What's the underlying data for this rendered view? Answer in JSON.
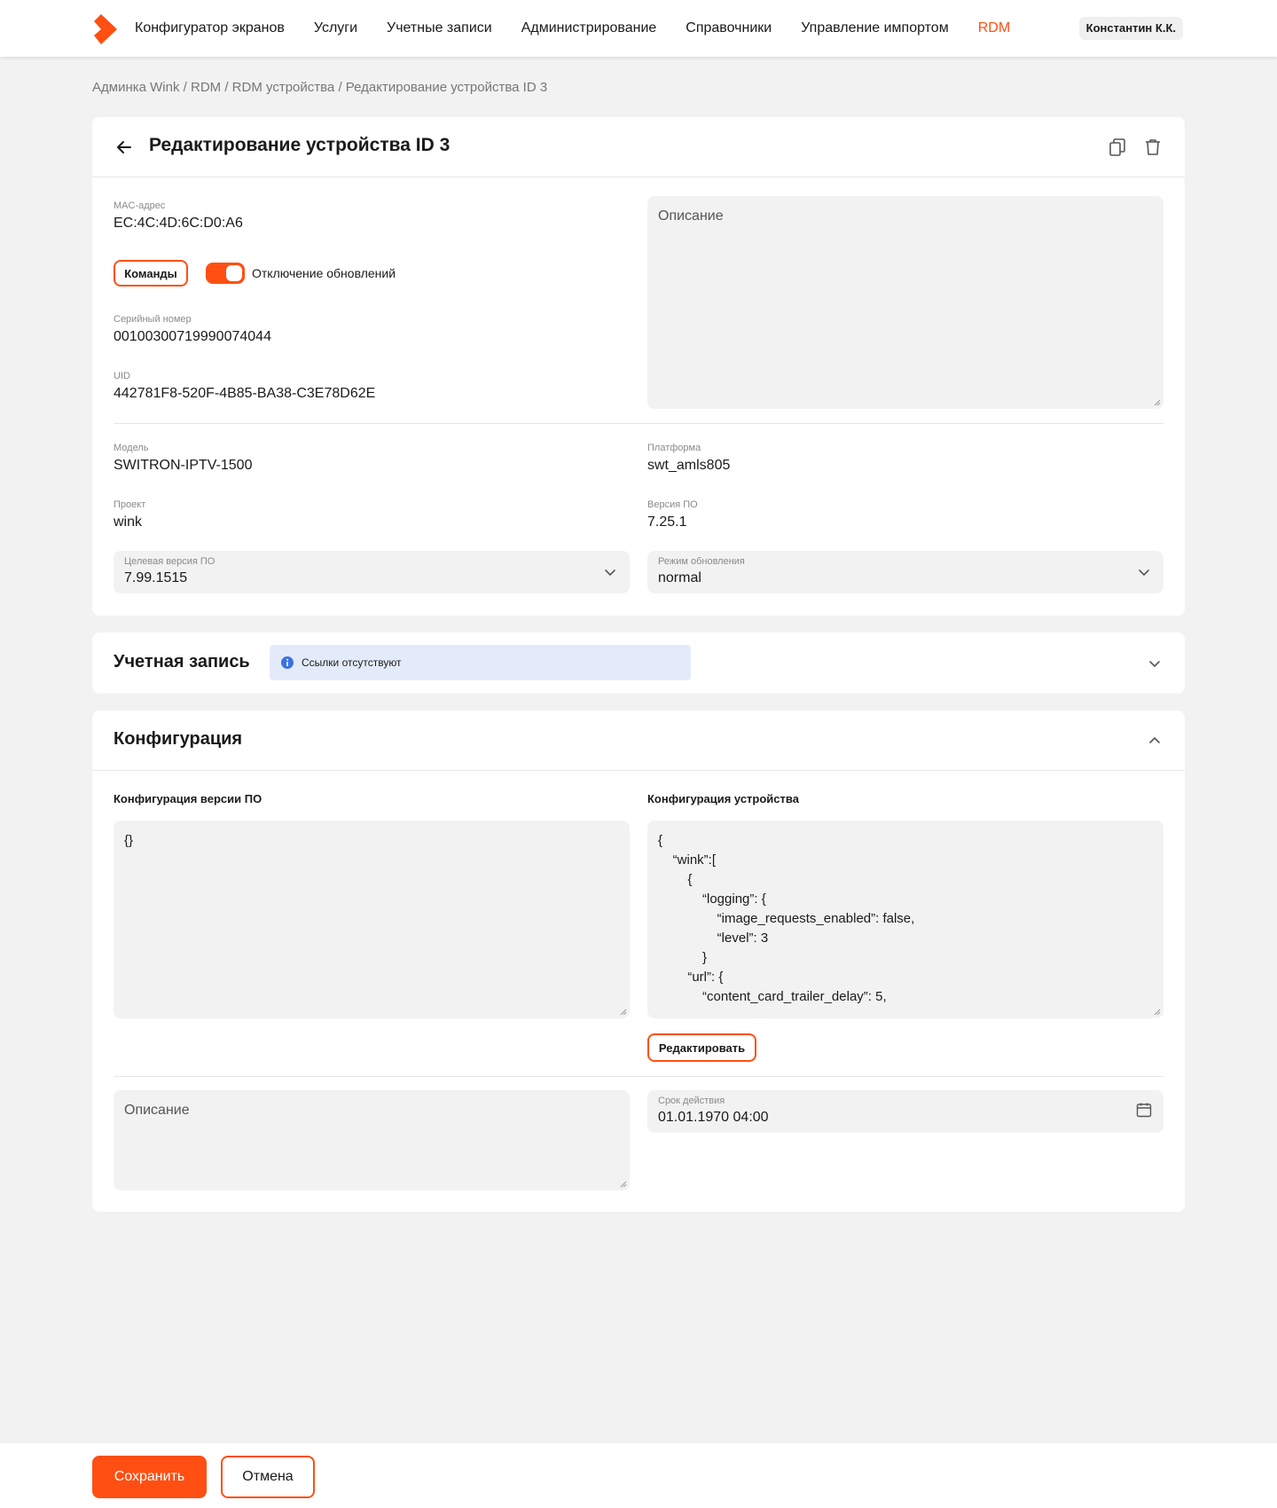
{
  "brand": {
    "accent_color": "#ff4f12",
    "logo_icon": "wink-logo-icon"
  },
  "nav": {
    "items": [
      {
        "label": "Конфигуратор экранов"
      },
      {
        "label": "Услуги"
      },
      {
        "label": "Учетные записи"
      },
      {
        "label": "Администрирование"
      },
      {
        "label": "Справочники"
      },
      {
        "label": "Управление импортом"
      },
      {
        "label": "RDM",
        "active": true
      }
    ],
    "user": "Константин К.К."
  },
  "breadcrumb": {
    "items": [
      "Админка Wink",
      "RDM",
      "RDM устройства",
      "Редактирование устройства ID 3"
    ],
    "separator": " / "
  },
  "device": {
    "title": "Редактирование устройства ID 3",
    "mac": {
      "label": "MAC-адрес",
      "value": "EC:4C:4D:6C:D0:A6"
    },
    "commands_button": "Команды",
    "updates_toggle": {
      "label": "Отключение обновлений",
      "on": true
    },
    "serial": {
      "label": "Серийный номер",
      "value": "00100300719990074044"
    },
    "uid": {
      "label": "UID",
      "value": "442781F8-520F-4B85-BA38-C3E78D62E"
    },
    "description_placeholder": "Описание",
    "model": {
      "label": "Модель",
      "value": "SWITRON-IPTV-1500"
    },
    "platform": {
      "label": "Платформа",
      "value": "swt_amls805"
    },
    "project": {
      "label": "Проект",
      "value": "wink"
    },
    "fw_version": {
      "label": "Версия ПО",
      "value": "7.25.1"
    },
    "target_fw": {
      "label": "Целевая версия ПО",
      "value": "7.99.1515"
    },
    "update_mode": {
      "label": "Режим обновления",
      "value": "normal"
    }
  },
  "account": {
    "title": "Учетная запись",
    "info": "Ссылки отсутствуют"
  },
  "config": {
    "title": "Конфигурация",
    "fw_config_label": "Конфигурация версии ПО",
    "fw_config_value": "{}",
    "device_config_label": "Конфигурация устройства",
    "device_config_lines": [
      "{",
      "    “wink”:[",
      "        {",
      "            “logging”: {",
      "                “image_requests_enabled”: false,",
      "                “level”: 3",
      "            }",
      "        “url”: {",
      "            “content_card_trailer_delay”: 5,"
    ],
    "edit_button": "Редактировать",
    "description_placeholder": "Описание",
    "expiry": {
      "label": "Срок действия",
      "value": "01.01.1970 04:00"
    }
  },
  "footer": {
    "save": "Сохранить",
    "cancel": "Отмена"
  }
}
